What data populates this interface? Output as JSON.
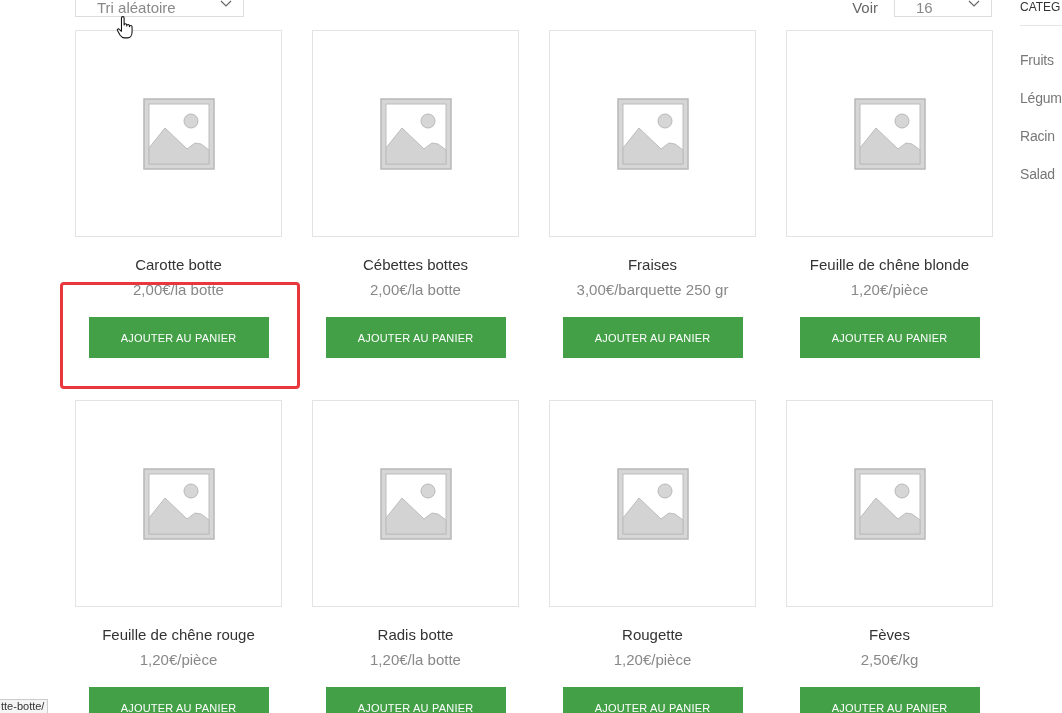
{
  "toolbar": {
    "sort": {
      "value": "Tri aléatoire"
    },
    "per_page": {
      "label": "Voir",
      "value": "16"
    }
  },
  "products": [
    {
      "name": "Carotte botte",
      "price": "2,00€/la botte",
      "button": "AJOUTER AU PANIER",
      "highlighted": true
    },
    {
      "name": "Cébettes bottes",
      "price": "2,00€/la botte",
      "button": "AJOUTER AU PANIER",
      "highlighted": false
    },
    {
      "name": "Fraises",
      "price": "3,00€/barquette 250 gr",
      "button": "AJOUTER AU PANIER",
      "highlighted": false
    },
    {
      "name": "Feuille de chêne blonde",
      "price": "1,20€/pièce",
      "button": "AJOUTER AU PANIER",
      "highlighted": false
    },
    {
      "name": "Feuille de chêne rouge",
      "price": "1,20€/pièce",
      "button": "AJOUTER AU PANIER",
      "highlighted": false
    },
    {
      "name": "Radis botte",
      "price": "1,20€/la botte",
      "button": "AJOUTER AU PANIER",
      "highlighted": false
    },
    {
      "name": "Rougette",
      "price": "1,20€/pièce",
      "button": "AJOUTER AU PANIER",
      "highlighted": false
    },
    {
      "name": "Fèves",
      "price": "2,50€/kg",
      "button": "AJOUTER AU PANIER",
      "highlighted": false
    }
  ],
  "sidebar": {
    "heading": "CATEG",
    "items": [
      "Fruits",
      "Légum",
      "Racin",
      "Salad"
    ]
  },
  "status_bar": {
    "url": "tte-botte/"
  }
}
